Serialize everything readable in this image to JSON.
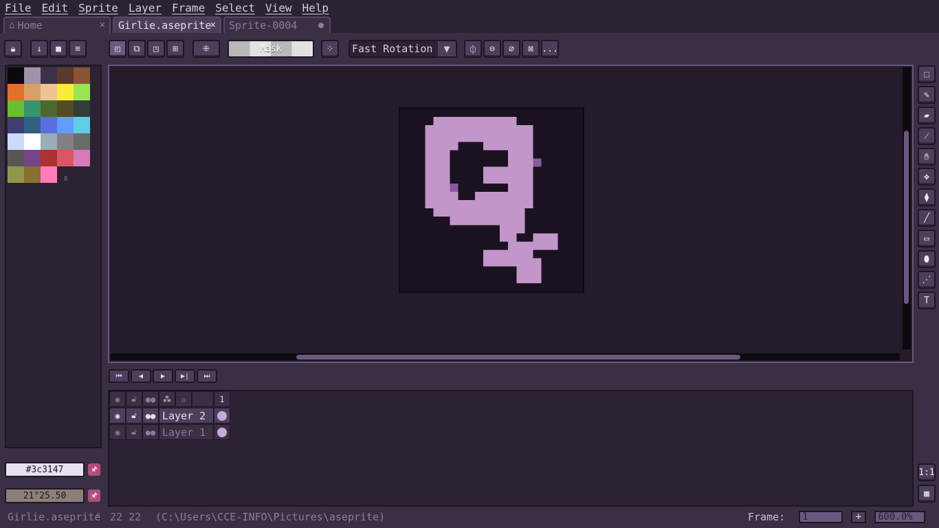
{
  "menu": [
    "File",
    "Edit",
    "Sprite",
    "Layer",
    "Frame",
    "Select",
    "View",
    "Help"
  ],
  "tabs": [
    {
      "label": "Home",
      "icon": "home-icon"
    },
    {
      "label": "Girlie.aseprite"
    },
    {
      "label": "Sprite-0004"
    }
  ],
  "toolbar": {
    "mask_label": "Mask",
    "rotation_algorithm": "Fast Rotation",
    "more_label": "..."
  },
  "palette": {
    "colors": [
      "#0a0a0a",
      "#9e93a8",
      "#3c3147",
      "#5b3a2e",
      "#8a5535",
      "#e1702c",
      "#d9a066",
      "#edc492",
      "#f6ec3a",
      "#99e550",
      "#6abe30",
      "#37946e",
      "#4b692f",
      "#524b24",
      "#323c39",
      "#3f3f74",
      "#306082",
      "#5b6ee1",
      "#639bff",
      "#5fcde4",
      "#cbdbfc",
      "#ffffff",
      "#9badb7",
      "#847e87",
      "#696a6a",
      "#595652",
      "#76428a",
      "#ac3232",
      "#d95763",
      "#d77bba",
      "#8f974a",
      "#8a6f30",
      "#ff7bba"
    ],
    "handle": "॥"
  },
  "fg_color": {
    "label": "#3c3147",
    "color": "#3c3147"
  },
  "bg_color": {
    "label": "21°25.50",
    "color": "#8e8076"
  },
  "timeline": {
    "frame_header": "1",
    "layers": [
      {
        "name": "Layer 2",
        "active": true
      },
      {
        "name": "Layer 1",
        "active": false
      }
    ]
  },
  "zoom_buttons": {
    "one_to_one": "1:1"
  },
  "status": {
    "filename": "Girlie.aseprite",
    "size": "22 22",
    "path": "(C:\\Users\\CCE-INFO\\Pictures\\aseprite)",
    "frame_label": "Frame:",
    "frame_value": "1",
    "plus": "+",
    "zoom": "600.0%"
  },
  "colors": {
    "accent": "#6b5880",
    "sprite_pink": "#c396c9",
    "sprite_dark": "#8a5a9e"
  }
}
